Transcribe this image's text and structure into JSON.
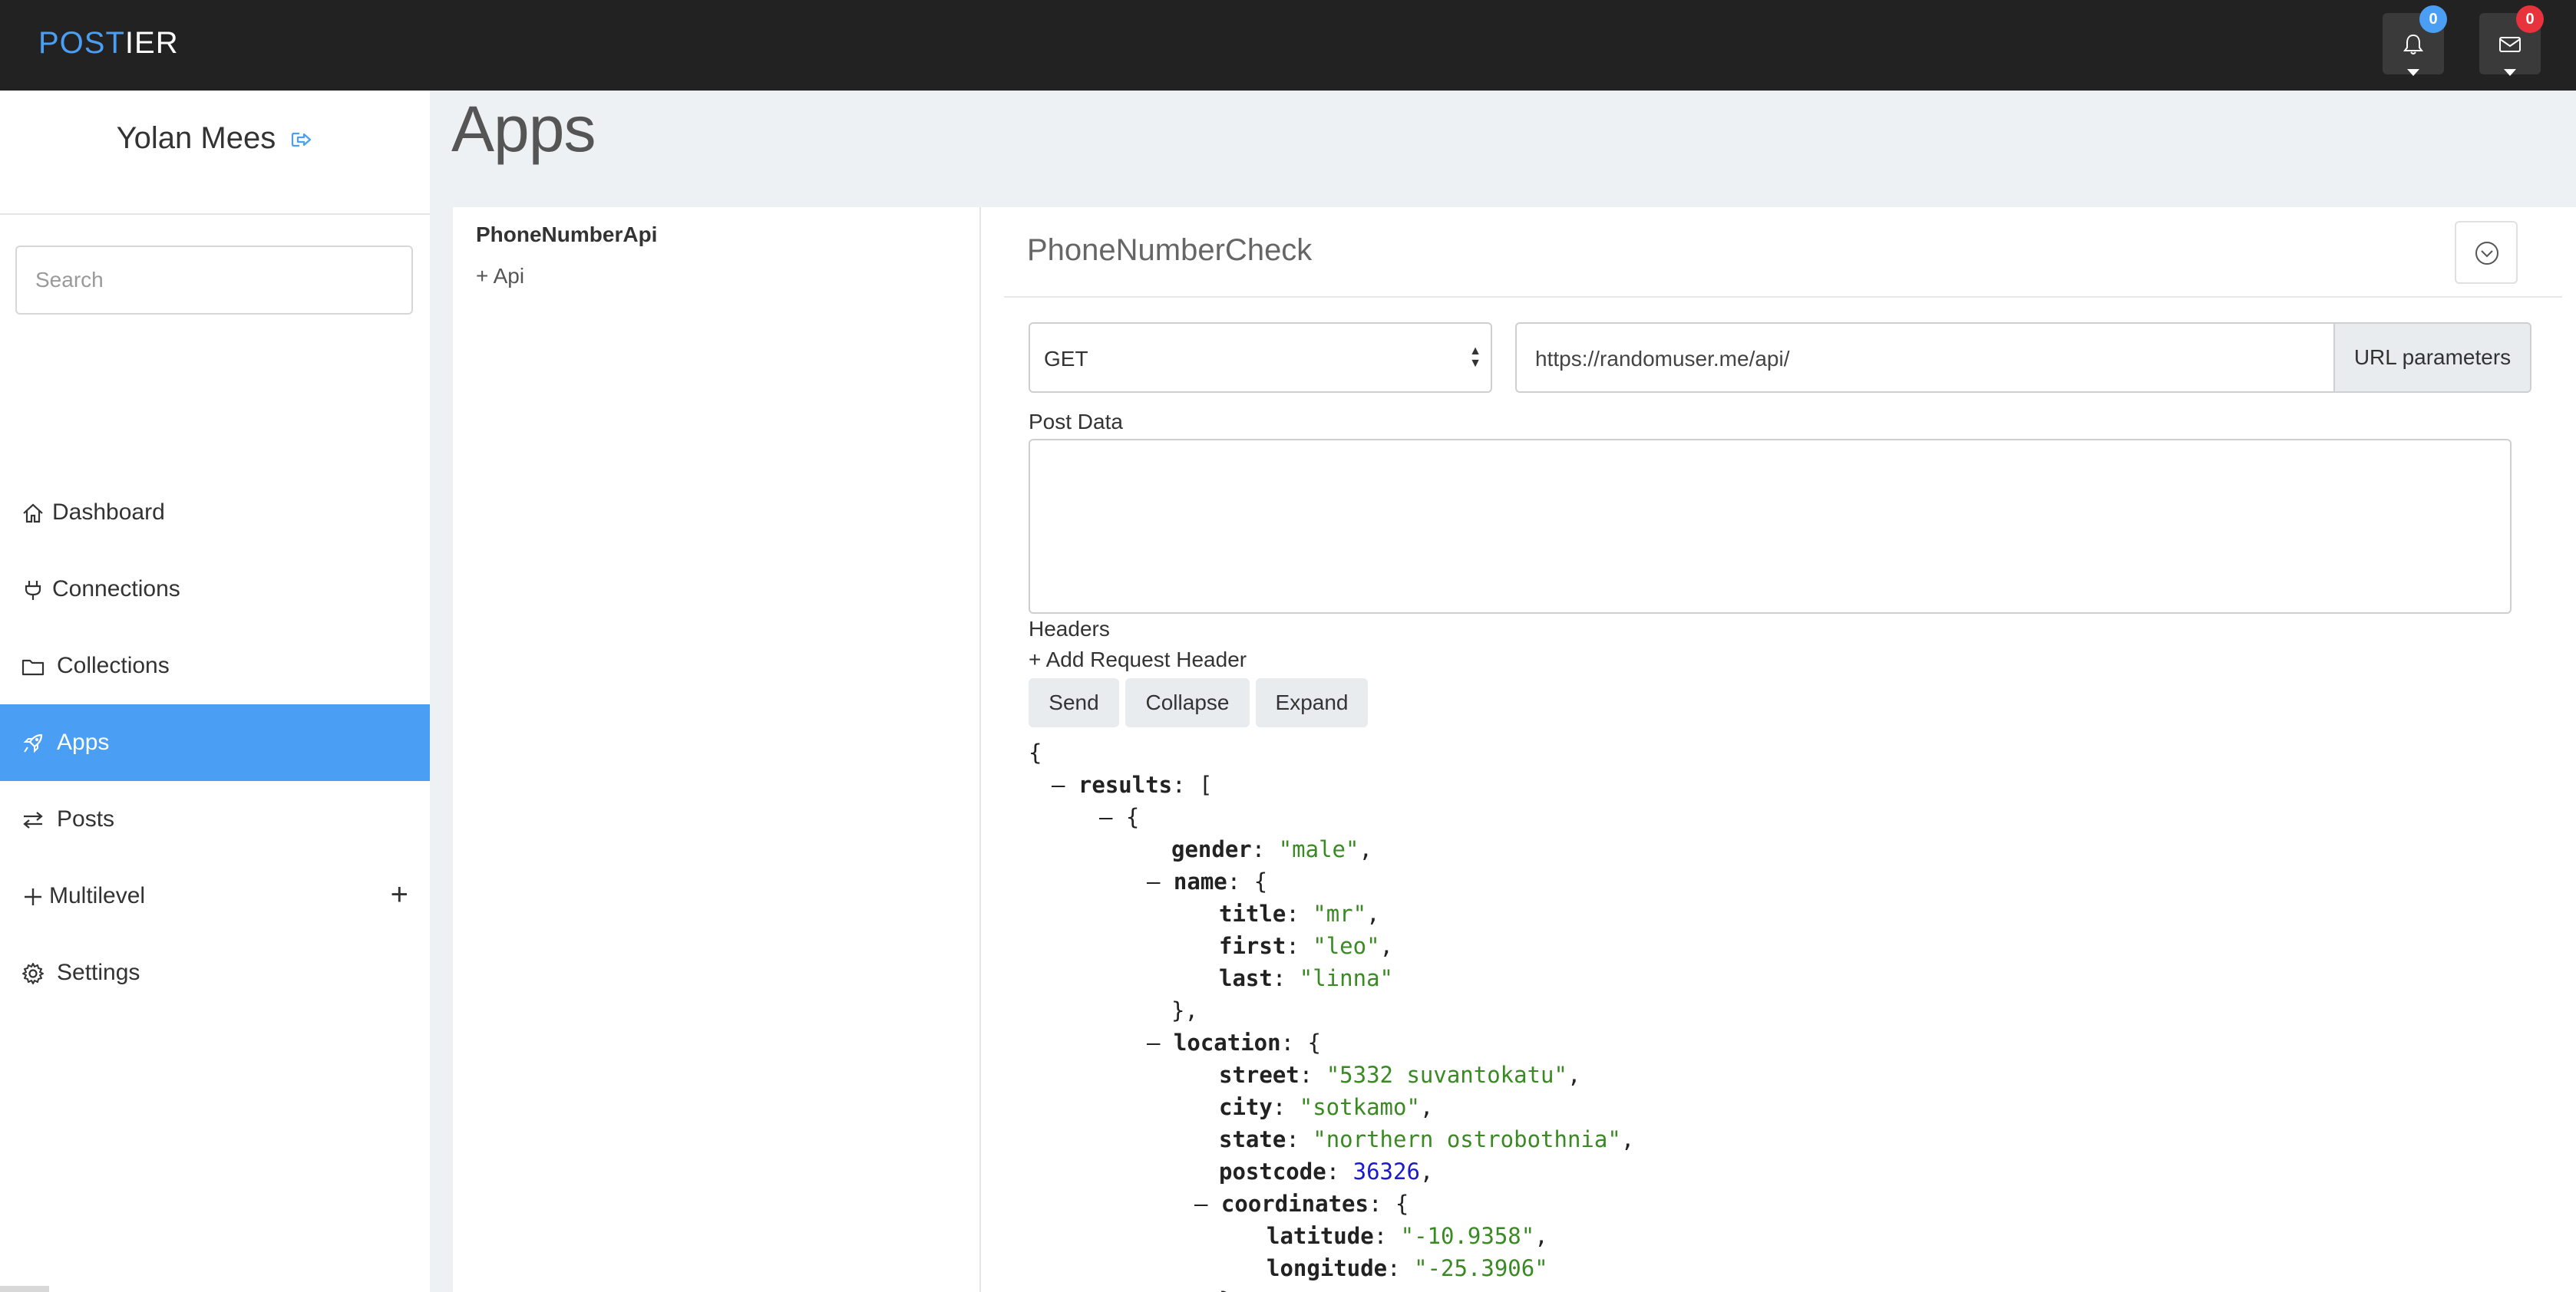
{
  "brand": {
    "part1": "POST",
    "part2": "IER"
  },
  "header": {
    "notifications_count": "0",
    "messages_count": "0",
    "badge_blue": "#4a9ff5",
    "badge_red": "#e8323c"
  },
  "user": {
    "name": "Yolan Mees"
  },
  "search": {
    "placeholder": "Search",
    "value": ""
  },
  "nav": {
    "items": [
      {
        "label": "Dashboard",
        "icon": "home-icon"
      },
      {
        "label": "Connections",
        "icon": "plug-icon"
      },
      {
        "label": "Collections",
        "icon": "folder-icon"
      },
      {
        "label": "Apps",
        "icon": "rocket-icon",
        "active": true
      },
      {
        "label": "Posts",
        "icon": "exchange-icon"
      },
      {
        "label": "Multilevel",
        "icon": "plus-icon",
        "expand": "+"
      },
      {
        "label": "Settings",
        "icon": "gear-icon"
      }
    ]
  },
  "page": {
    "title": "Apps"
  },
  "apps": {
    "app_name": "PhoneNumberApi",
    "add_api": "+ Api"
  },
  "request": {
    "title": "PhoneNumberCheck",
    "method": "GET",
    "url": "https://randomuser.me/api/",
    "url_params_label": "URL parameters",
    "post_data_label": "Post Data",
    "post_data_value": "",
    "headers_label": "Headers",
    "add_header_label": "+ Add Request Header",
    "send_label": "Send",
    "collapse_label": "Collapse",
    "expand_label": "Expand"
  },
  "response": {
    "lines": [
      {
        "indent": 0,
        "text": "{"
      },
      {
        "indent": 1,
        "toggle": "–",
        "key": "results",
        "sep": ": ",
        "tail": "["
      },
      {
        "indent": 2,
        "toggle": "–",
        "tail": "{"
      },
      {
        "indent": 3,
        "key": "gender",
        "sep": ": ",
        "str": "\"male\"",
        "tail": ","
      },
      {
        "indent": 3,
        "toggle": "–",
        "key": "name",
        "sep": ": ",
        "tail": "{"
      },
      {
        "indent": 4,
        "key": "title",
        "sep": ": ",
        "str": "\"mr\"",
        "tail": ","
      },
      {
        "indent": 4,
        "key": "first",
        "sep": ": ",
        "str": "\"leo\"",
        "tail": ","
      },
      {
        "indent": 4,
        "key": "last",
        "sep": ": ",
        "str": "\"linna\""
      },
      {
        "indent": 3,
        "text": "},",
        "close": true
      },
      {
        "indent": 3,
        "toggle": "–",
        "key": "location",
        "sep": ": ",
        "tail": "{"
      },
      {
        "indent": 4,
        "key": "street",
        "sep": ": ",
        "str": "\"5332 suvantokatu\"",
        "tail": ","
      },
      {
        "indent": 4,
        "key": "city",
        "sep": ": ",
        "str": "\"sotkamo\"",
        "tail": ","
      },
      {
        "indent": 4,
        "key": "state",
        "sep": ": ",
        "str": "\"northern ostrobothnia\"",
        "tail": ","
      },
      {
        "indent": 4,
        "key": "postcode",
        "sep": ": ",
        "num": "36326",
        "tail": ","
      },
      {
        "indent": 4,
        "toggle": "–",
        "key": "coordinates",
        "sep": ": ",
        "tail": "{"
      },
      {
        "indent": 5,
        "key": "latitude",
        "sep": ": ",
        "str": "\"-10.9358\"",
        "tail": ","
      },
      {
        "indent": 5,
        "key": "longitude",
        "sep": ": ",
        "str": "\"-25.3906\""
      },
      {
        "indent": 4,
        "text": "}",
        "close": true
      }
    ]
  }
}
